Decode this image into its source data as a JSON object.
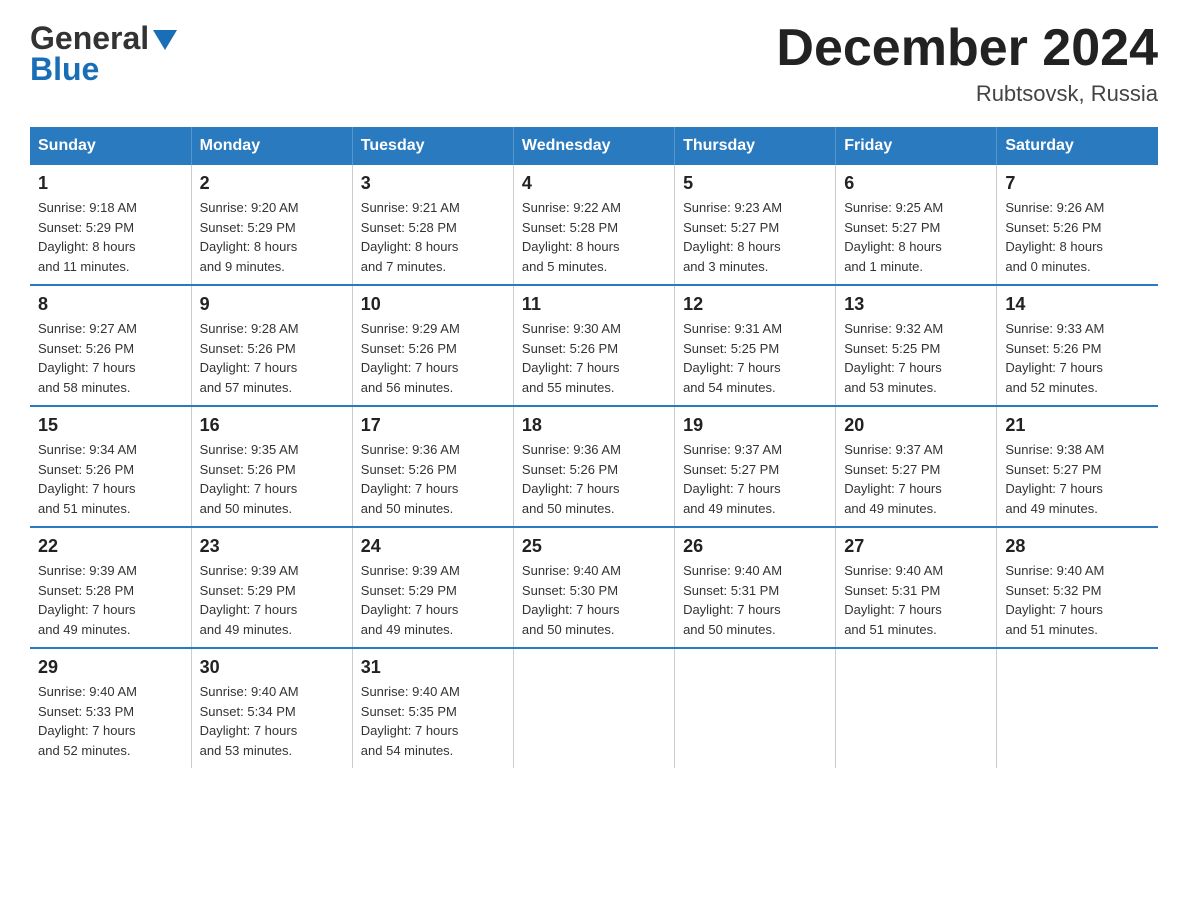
{
  "header": {
    "logo_general": "General",
    "logo_blue": "Blue",
    "month_title": "December 2024",
    "location": "Rubtsovsk, Russia"
  },
  "days_of_week": [
    "Sunday",
    "Monday",
    "Tuesday",
    "Wednesday",
    "Thursday",
    "Friday",
    "Saturday"
  ],
  "weeks": [
    [
      {
        "day": "1",
        "sunrise": "Sunrise: 9:18 AM",
        "sunset": "Sunset: 5:29 PM",
        "daylight": "Daylight: 8 hours",
        "daylight2": "and 11 minutes."
      },
      {
        "day": "2",
        "sunrise": "Sunrise: 9:20 AM",
        "sunset": "Sunset: 5:29 PM",
        "daylight": "Daylight: 8 hours",
        "daylight2": "and 9 minutes."
      },
      {
        "day": "3",
        "sunrise": "Sunrise: 9:21 AM",
        "sunset": "Sunset: 5:28 PM",
        "daylight": "Daylight: 8 hours",
        "daylight2": "and 7 minutes."
      },
      {
        "day": "4",
        "sunrise": "Sunrise: 9:22 AM",
        "sunset": "Sunset: 5:28 PM",
        "daylight": "Daylight: 8 hours",
        "daylight2": "and 5 minutes."
      },
      {
        "day": "5",
        "sunrise": "Sunrise: 9:23 AM",
        "sunset": "Sunset: 5:27 PM",
        "daylight": "Daylight: 8 hours",
        "daylight2": "and 3 minutes."
      },
      {
        "day": "6",
        "sunrise": "Sunrise: 9:25 AM",
        "sunset": "Sunset: 5:27 PM",
        "daylight": "Daylight: 8 hours",
        "daylight2": "and 1 minute."
      },
      {
        "day": "7",
        "sunrise": "Sunrise: 9:26 AM",
        "sunset": "Sunset: 5:26 PM",
        "daylight": "Daylight: 8 hours",
        "daylight2": "and 0 minutes."
      }
    ],
    [
      {
        "day": "8",
        "sunrise": "Sunrise: 9:27 AM",
        "sunset": "Sunset: 5:26 PM",
        "daylight": "Daylight: 7 hours",
        "daylight2": "and 58 minutes."
      },
      {
        "day": "9",
        "sunrise": "Sunrise: 9:28 AM",
        "sunset": "Sunset: 5:26 PM",
        "daylight": "Daylight: 7 hours",
        "daylight2": "and 57 minutes."
      },
      {
        "day": "10",
        "sunrise": "Sunrise: 9:29 AM",
        "sunset": "Sunset: 5:26 PM",
        "daylight": "Daylight: 7 hours",
        "daylight2": "and 56 minutes."
      },
      {
        "day": "11",
        "sunrise": "Sunrise: 9:30 AM",
        "sunset": "Sunset: 5:26 PM",
        "daylight": "Daylight: 7 hours",
        "daylight2": "and 55 minutes."
      },
      {
        "day": "12",
        "sunrise": "Sunrise: 9:31 AM",
        "sunset": "Sunset: 5:25 PM",
        "daylight": "Daylight: 7 hours",
        "daylight2": "and 54 minutes."
      },
      {
        "day": "13",
        "sunrise": "Sunrise: 9:32 AM",
        "sunset": "Sunset: 5:25 PM",
        "daylight": "Daylight: 7 hours",
        "daylight2": "and 53 minutes."
      },
      {
        "day": "14",
        "sunrise": "Sunrise: 9:33 AM",
        "sunset": "Sunset: 5:26 PM",
        "daylight": "Daylight: 7 hours",
        "daylight2": "and 52 minutes."
      }
    ],
    [
      {
        "day": "15",
        "sunrise": "Sunrise: 9:34 AM",
        "sunset": "Sunset: 5:26 PM",
        "daylight": "Daylight: 7 hours",
        "daylight2": "and 51 minutes."
      },
      {
        "day": "16",
        "sunrise": "Sunrise: 9:35 AM",
        "sunset": "Sunset: 5:26 PM",
        "daylight": "Daylight: 7 hours",
        "daylight2": "and 50 minutes."
      },
      {
        "day": "17",
        "sunrise": "Sunrise: 9:36 AM",
        "sunset": "Sunset: 5:26 PM",
        "daylight": "Daylight: 7 hours",
        "daylight2": "and 50 minutes."
      },
      {
        "day": "18",
        "sunrise": "Sunrise: 9:36 AM",
        "sunset": "Sunset: 5:26 PM",
        "daylight": "Daylight: 7 hours",
        "daylight2": "and 50 minutes."
      },
      {
        "day": "19",
        "sunrise": "Sunrise: 9:37 AM",
        "sunset": "Sunset: 5:27 PM",
        "daylight": "Daylight: 7 hours",
        "daylight2": "and 49 minutes."
      },
      {
        "day": "20",
        "sunrise": "Sunrise: 9:37 AM",
        "sunset": "Sunset: 5:27 PM",
        "daylight": "Daylight: 7 hours",
        "daylight2": "and 49 minutes."
      },
      {
        "day": "21",
        "sunrise": "Sunrise: 9:38 AM",
        "sunset": "Sunset: 5:27 PM",
        "daylight": "Daylight: 7 hours",
        "daylight2": "and 49 minutes."
      }
    ],
    [
      {
        "day": "22",
        "sunrise": "Sunrise: 9:39 AM",
        "sunset": "Sunset: 5:28 PM",
        "daylight": "Daylight: 7 hours",
        "daylight2": "and 49 minutes."
      },
      {
        "day": "23",
        "sunrise": "Sunrise: 9:39 AM",
        "sunset": "Sunset: 5:29 PM",
        "daylight": "Daylight: 7 hours",
        "daylight2": "and 49 minutes."
      },
      {
        "day": "24",
        "sunrise": "Sunrise: 9:39 AM",
        "sunset": "Sunset: 5:29 PM",
        "daylight": "Daylight: 7 hours",
        "daylight2": "and 49 minutes."
      },
      {
        "day": "25",
        "sunrise": "Sunrise: 9:40 AM",
        "sunset": "Sunset: 5:30 PM",
        "daylight": "Daylight: 7 hours",
        "daylight2": "and 50 minutes."
      },
      {
        "day": "26",
        "sunrise": "Sunrise: 9:40 AM",
        "sunset": "Sunset: 5:31 PM",
        "daylight": "Daylight: 7 hours",
        "daylight2": "and 50 minutes."
      },
      {
        "day": "27",
        "sunrise": "Sunrise: 9:40 AM",
        "sunset": "Sunset: 5:31 PM",
        "daylight": "Daylight: 7 hours",
        "daylight2": "and 51 minutes."
      },
      {
        "day": "28",
        "sunrise": "Sunrise: 9:40 AM",
        "sunset": "Sunset: 5:32 PM",
        "daylight": "Daylight: 7 hours",
        "daylight2": "and 51 minutes."
      }
    ],
    [
      {
        "day": "29",
        "sunrise": "Sunrise: 9:40 AM",
        "sunset": "Sunset: 5:33 PM",
        "daylight": "Daylight: 7 hours",
        "daylight2": "and 52 minutes."
      },
      {
        "day": "30",
        "sunrise": "Sunrise: 9:40 AM",
        "sunset": "Sunset: 5:34 PM",
        "daylight": "Daylight: 7 hours",
        "daylight2": "and 53 minutes."
      },
      {
        "day": "31",
        "sunrise": "Sunrise: 9:40 AM",
        "sunset": "Sunset: 5:35 PM",
        "daylight": "Daylight: 7 hours",
        "daylight2": "and 54 minutes."
      },
      null,
      null,
      null,
      null
    ]
  ]
}
